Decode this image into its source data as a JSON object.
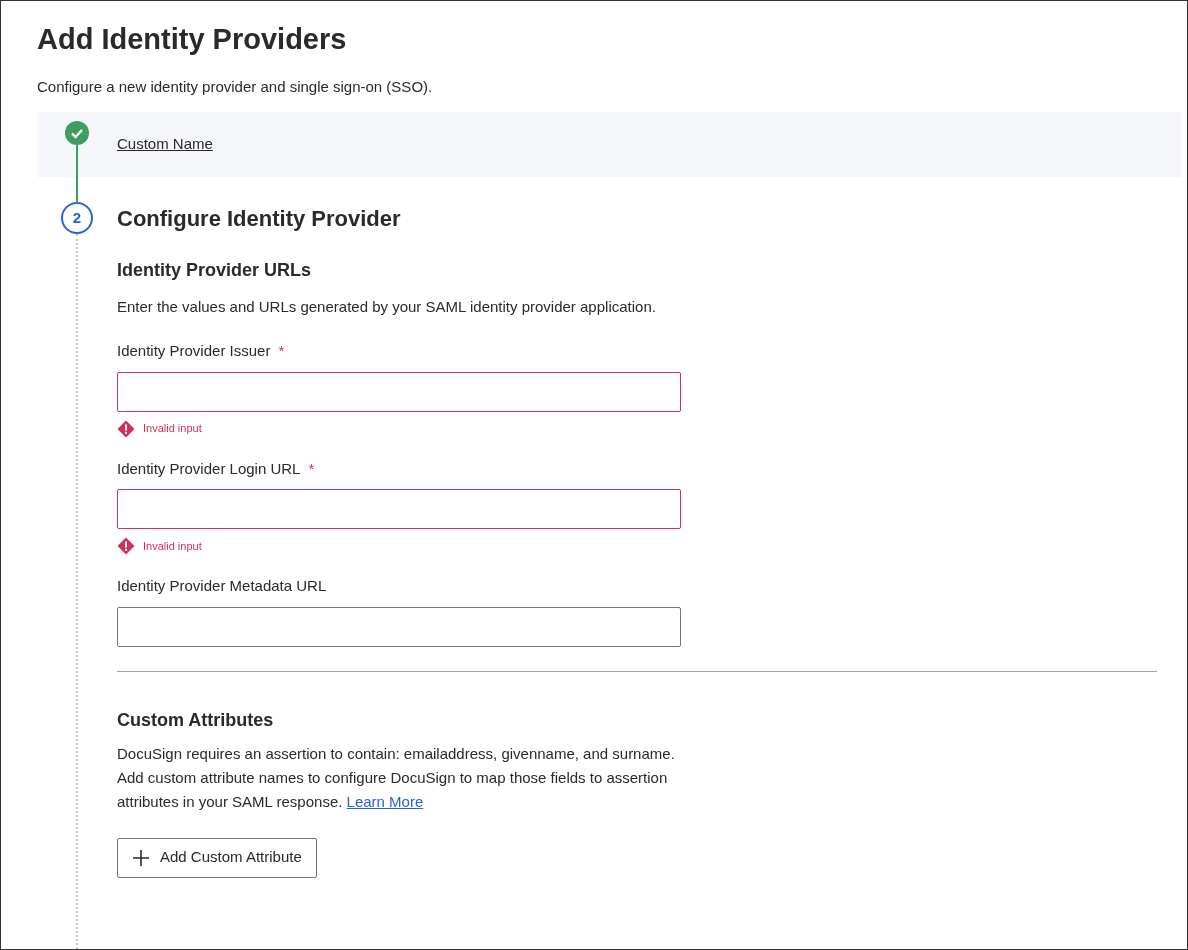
{
  "page": {
    "title": "Add Identity Providers",
    "subtitle": "Configure a new identity provider and single sign-on (SSO)."
  },
  "steps": [
    {
      "kind": "complete",
      "label": "Custom Name"
    },
    {
      "kind": "current",
      "number": "2",
      "title": "Configure Identity Provider"
    }
  ],
  "sections": [
    {
      "heading": "Identity Provider URLs",
      "description": "Enter the values and URLs generated by your SAML identity provider application.",
      "fields": [
        {
          "label": "Identity Provider Issuer",
          "required_mark": "*",
          "invalid": true,
          "error": "Invalid input"
        },
        {
          "label": "Identity Provider Login URL",
          "required_mark": "*",
          "invalid": true,
          "error": "Invalid input"
        },
        {
          "label": "Identity Provider Metadata URL",
          "invalid": false
        }
      ]
    },
    {
      "heading": "Custom Attributes",
      "description": "DocuSign requires an assertion to contain: emailaddress, givenname, and surname. Add custom attribute names to configure DocuSign to map those fields to assertion attributes in your SAML response.",
      "link": "Learn More",
      "button": "Add Custom Attribute"
    }
  ]
}
